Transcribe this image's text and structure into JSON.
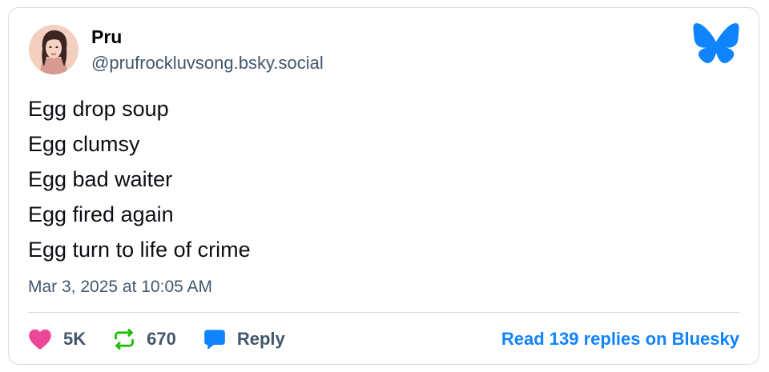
{
  "author": {
    "display_name": "Pru",
    "handle": "@prufrockluvsong.bsky.social",
    "avatar_icon": "portrait-avatar"
  },
  "brand": {
    "logo_icon": "bluesky-butterfly-icon",
    "color": "#1083fe"
  },
  "post": {
    "lines": [
      "Egg drop soup",
      "Egg clumsy",
      "Egg bad waiter",
      "Egg fired again",
      "Egg turn to life of crime"
    ],
    "timestamp": "Mar 3, 2025 at 10:05 AM"
  },
  "actions": {
    "likes": "5K",
    "reposts": "670",
    "reply_label": "Reply",
    "read_more": "Read 139 replies on Bluesky"
  },
  "colors": {
    "like": "#ec4899",
    "repost": "#20bc07",
    "reply": "#1083fe",
    "muted_text": "#42576c",
    "border": "#d4dbe2"
  }
}
